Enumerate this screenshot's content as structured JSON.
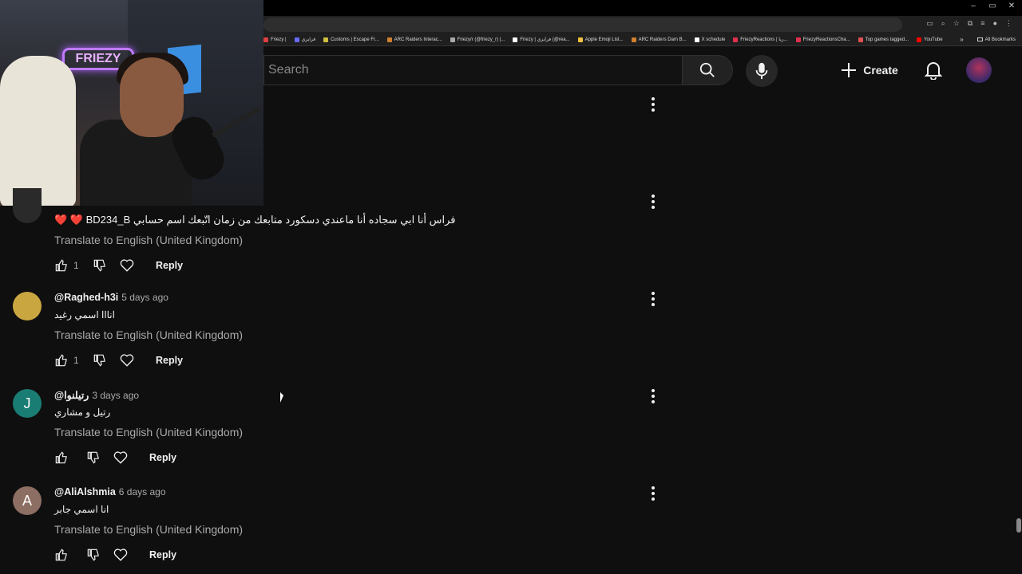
{
  "browser": {
    "window_controls": [
      "–",
      "▭",
      "✕"
    ],
    "bookmarks": [
      {
        "label": "Friezy |",
        "color": "#e04040"
      },
      {
        "label": "فرايزي",
        "color": "#6a6aff"
      },
      {
        "label": "Customs | Escape Fr...",
        "color": "#d0c040"
      },
      {
        "label": "ARC Raiders Interac...",
        "color": "#d08030"
      },
      {
        "label": "Friezy/r (@friezy_r) |...",
        "color": "#aaaaaa"
      },
      {
        "label": "Friezy | فرايزي (@rea...",
        "color": "#ffffff"
      },
      {
        "label": "Apple Emoji List...",
        "color": "#f0c040"
      },
      {
        "label": "ARC Raiders Dam B...",
        "color": "#d08030"
      },
      {
        "label": "X schedule",
        "color": "#ffffff"
      },
      {
        "label": "FriezyReactions | ريا...",
        "color": "#e03050"
      },
      {
        "label": "FriezyReactionsCha...",
        "color": "#e03050"
      },
      {
        "label": "Top games tagged...",
        "color": "#e05050"
      },
      {
        "label": "YouTube",
        "color": "#ff0000"
      }
    ],
    "overflow": "»",
    "all_bookmarks": "All Bookmarks"
  },
  "header": {
    "search_placeholder": "Search",
    "create_label": "Create"
  },
  "comments": [
    {
      "author": "",
      "time": "",
      "avatar_letter": "",
      "avatar_color": "#2a2a2a",
      "text": "❤️ ❤️ BD234_B فراس أنا ابي سجاده أنا ماعندي دسكورد متابعك من زمان اتّبعك اسم حسابي",
      "translate": "Translate to English (United Kingdom)",
      "likes": "1",
      "reply": "Reply"
    },
    {
      "author": "@Raghed-h3i",
      "time": "5 days ago",
      "avatar_letter": "",
      "avatar_color": "#c9a640",
      "text": "انااا اسمي رغيد",
      "translate": "Translate to English (United Kingdom)",
      "likes": "1",
      "reply": "Reply"
    },
    {
      "author": "@رتيلنوا",
      "time": "3 days ago",
      "avatar_letter": "J",
      "avatar_color": "#1a7d74",
      "text": "رتيل و مشاري",
      "translate": "Translate to English (United Kingdom)",
      "likes": "",
      "reply": "Reply"
    },
    {
      "author": "@AliAlshmia",
      "time": "6 days ago",
      "avatar_letter": "A",
      "avatar_color": "#8d6e63",
      "text": "انا اسمي جابر",
      "translate": "Translate to English (United Kingdom)",
      "likes": "",
      "reply": "Reply"
    }
  ]
}
